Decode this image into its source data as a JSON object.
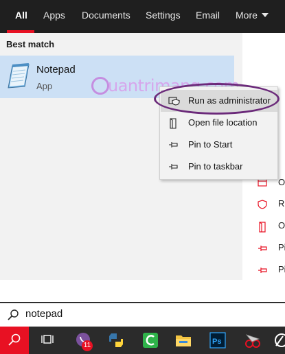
{
  "tabs": [
    {
      "label": "All"
    },
    {
      "label": "Apps"
    },
    {
      "label": "Documents"
    },
    {
      "label": "Settings"
    },
    {
      "label": "Email"
    },
    {
      "label": "More"
    }
  ],
  "results": {
    "section_title": "Best match",
    "best_match": {
      "name": "Notepad",
      "type": "App"
    }
  },
  "watermark": {
    "text": "uantrimang.com"
  },
  "context_menu": {
    "items": [
      {
        "label": "Run as administrator",
        "icon": "shield-icon"
      },
      {
        "label": "Open file location",
        "icon": "file-icon"
      },
      {
        "label": "Pin to Start",
        "icon": "pin-icon"
      },
      {
        "label": "Pin to taskbar",
        "icon": "pin-icon"
      }
    ]
  },
  "right_pane": {
    "rows": [
      {
        "letter": "O",
        "icon": "open-icon"
      },
      {
        "letter": "Ru",
        "icon": "shield-icon"
      },
      {
        "letter": "O",
        "icon": "file-icon"
      },
      {
        "letter": "Pi",
        "icon": "pin-icon"
      },
      {
        "letter": "Pi",
        "icon": "pin-icon"
      }
    ]
  },
  "search": {
    "query": "notepad"
  },
  "taskbar": {
    "items": [
      {
        "icon": "search-icon"
      },
      {
        "icon": "task-view-icon"
      },
      {
        "icon": "viber-icon",
        "badge": "11"
      },
      {
        "icon": "python-icon"
      },
      {
        "icon": "camtasia-icon"
      },
      {
        "icon": "file-explorer-icon"
      },
      {
        "icon": "photoshop-icon"
      },
      {
        "icon": "snipping-tool-icon"
      },
      {
        "icon": "app-icon"
      }
    ]
  },
  "colors": {
    "accent": "#e81123",
    "selection": "#cce0f5",
    "tabbar": "#1f1f1f",
    "annotation": "#6b2a7a"
  }
}
